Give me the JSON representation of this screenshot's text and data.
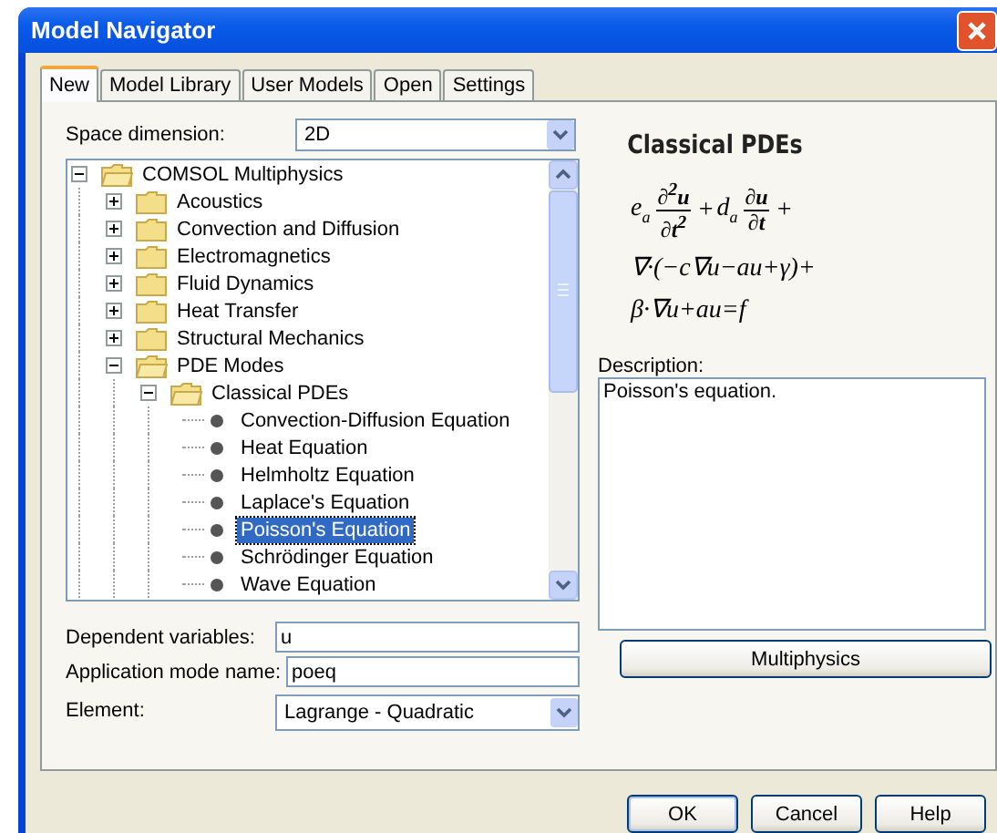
{
  "window": {
    "title": "Model Navigator"
  },
  "tabs": [
    {
      "label": "New",
      "selected": true
    },
    {
      "label": "Model Library",
      "selected": false
    },
    {
      "label": "User Models",
      "selected": false
    },
    {
      "label": "Open",
      "selected": false
    },
    {
      "label": "Settings",
      "selected": false
    }
  ],
  "space_dimension": {
    "label": "Space dimension:",
    "value": "2D"
  },
  "tree": [
    {
      "label": "COMSOL Multiphysics",
      "kind": "folder",
      "expanded": true,
      "selected": false,
      "children": [
        {
          "label": "Acoustics",
          "kind": "folder",
          "expanded": false,
          "selected": false
        },
        {
          "label": "Convection and Diffusion",
          "kind": "folder",
          "expanded": false,
          "selected": false
        },
        {
          "label": "Electromagnetics",
          "kind": "folder",
          "expanded": false,
          "selected": false
        },
        {
          "label": "Fluid Dynamics",
          "kind": "folder",
          "expanded": false,
          "selected": false
        },
        {
          "label": "Heat Transfer",
          "kind": "folder",
          "expanded": false,
          "selected": false
        },
        {
          "label": "Structural Mechanics",
          "kind": "folder",
          "expanded": false,
          "selected": false
        },
        {
          "label": "PDE Modes",
          "kind": "folder",
          "expanded": true,
          "selected": false,
          "children": [
            {
              "label": "Classical PDEs",
              "kind": "folder",
              "expanded": true,
              "selected": false,
              "children": [
                {
                  "label": "Convection-Diffusion Equation",
                  "kind": "leaf",
                  "selected": false
                },
                {
                  "label": "Heat Equation",
                  "kind": "leaf",
                  "selected": false
                },
                {
                  "label": "Helmholtz Equation",
                  "kind": "leaf",
                  "selected": false
                },
                {
                  "label": "Laplace's Equation",
                  "kind": "leaf",
                  "selected": false
                },
                {
                  "label": "Poisson's Equation",
                  "kind": "leaf",
                  "selected": true
                },
                {
                  "label": "Schrödinger Equation",
                  "kind": "leaf",
                  "selected": false
                },
                {
                  "label": "Wave Equation",
                  "kind": "leaf",
                  "selected": false
                }
              ]
            }
          ]
        }
      ]
    }
  ],
  "preview": {
    "title": "Classical PDEs",
    "formula": {
      "line_1": [
        {
          "kind": "term",
          "coefficient": "e",
          "subscript": "a",
          "numerator": "∂$^{2}$u",
          "denominator": "∂t$^{2}$"
        },
        {
          "kind": "operator",
          "text": "+"
        },
        {
          "kind": "term",
          "coefficient": "d",
          "subscript": "a",
          "numerator": "∂u",
          "denominator": "∂t"
        },
        {
          "kind": "operator",
          "text": "+"
        }
      ],
      "line_2": "∇·(−c∇u−au+γ)+",
      "line_3": "β·∇u+au=f"
    },
    "description_label": "Description:",
    "description": "Poisson's equation."
  },
  "fields": [
    {
      "kind": "text",
      "label": "Dependent variables:",
      "value": "u"
    },
    {
      "kind": "text",
      "label": "Application mode name:",
      "value": "poeq"
    },
    {
      "kind": "select",
      "label": "Element:",
      "value": "Lagrange - Quadratic"
    }
  ],
  "multiphysics_button": "Multiphysics",
  "buttons": [
    "OK",
    "Cancel",
    "Help"
  ]
}
